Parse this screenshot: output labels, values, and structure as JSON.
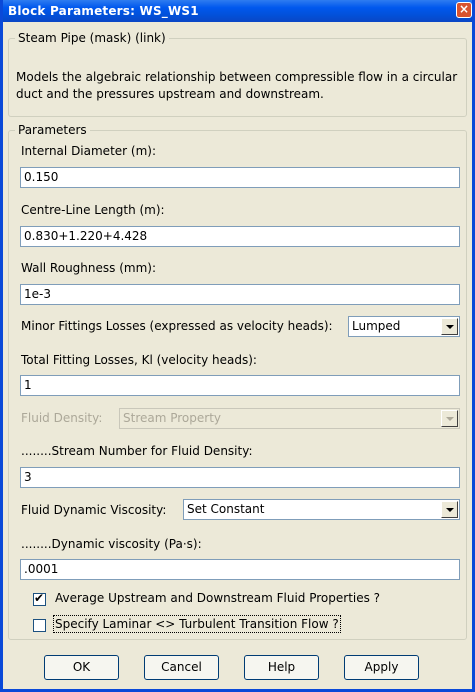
{
  "window": {
    "title": "Block Parameters: WS_WS1",
    "close_glyph": "×"
  },
  "mask": {
    "legend": "Steam Pipe (mask) (link)",
    "description_line1": "Models the algebraic relationship between compressible flow in a circular",
    "description_line2": "duct and the pressures upstream and downstream."
  },
  "params": {
    "legend": "Parameters",
    "internal_diameter": {
      "label": "Internal Diameter (m):",
      "value": "0.150"
    },
    "centre_line_length": {
      "label": "Centre-Line Length (m):",
      "value": "0.830+1.220+4.428"
    },
    "wall_roughness": {
      "label": "Wall Roughness (mm):",
      "value": "1e-3"
    },
    "minor_fittings": {
      "label": "Minor Fittings Losses (expressed as velocity heads):",
      "value": "Lumped"
    },
    "total_fitting_losses": {
      "label": "Total Fitting Losses, Kl (velocity heads):",
      "value": "1"
    },
    "fluid_density": {
      "label": "Fluid Density:",
      "value": "Stream Property"
    },
    "stream_number": {
      "label": "........Stream Number for Fluid Density:",
      "value": "3"
    },
    "fluid_viscosity": {
      "label": "Fluid Dynamic Viscosity:",
      "value": "Set Constant"
    },
    "dynamic_viscosity": {
      "label": "........Dynamic viscosity (Pa·s):",
      "value": ".0001"
    },
    "average_props": {
      "label": "Average Upstream and Downstream Fluid Properties ?",
      "checked": true
    },
    "laminar_transition": {
      "label": "Specify Laminar <> Turbulent Transition Flow ?",
      "checked": false
    }
  },
  "buttons": {
    "ok": "OK",
    "cancel": "Cancel",
    "help": "Help",
    "apply": "Apply"
  },
  "colors": {
    "titlebar": "#0058ee",
    "dialog_bg": "#ece9d8",
    "edit_border": "#7f9db9",
    "close": "#d9532f"
  }
}
